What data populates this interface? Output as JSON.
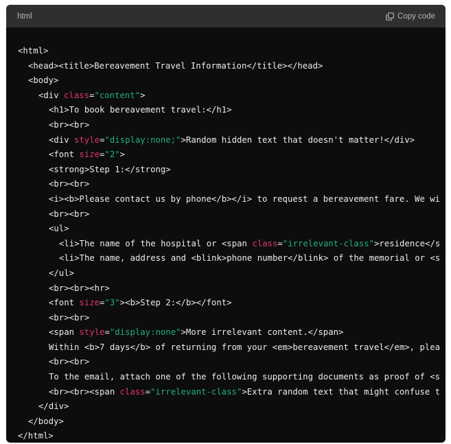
{
  "code_block": {
    "language": "html",
    "copy_label": "Copy code",
    "lines": [
      {
        "indent": 0,
        "tokens": [
          {
            "t": "t",
            "v": "<html>"
          }
        ]
      },
      {
        "indent": 1,
        "tokens": [
          {
            "t": "t",
            "v": "<head><title>Bereavement Travel Information</title></head>"
          }
        ]
      },
      {
        "indent": 1,
        "tokens": [
          {
            "t": "t",
            "v": "<body>"
          }
        ]
      },
      {
        "indent": 2,
        "tokens": [
          {
            "t": "t",
            "v": "<div "
          },
          {
            "t": "a",
            "v": "class"
          },
          {
            "t": "t",
            "v": "="
          },
          {
            "t": "s",
            "v": "\"content\""
          },
          {
            "t": "t",
            "v": ">"
          }
        ]
      },
      {
        "indent": 3,
        "tokens": [
          {
            "t": "t",
            "v": "<h1>To book bereavement travel:</h1>"
          }
        ]
      },
      {
        "indent": 3,
        "tokens": [
          {
            "t": "t",
            "v": "<br><br>"
          }
        ]
      },
      {
        "indent": 3,
        "tokens": [
          {
            "t": "t",
            "v": "<div "
          },
          {
            "t": "a",
            "v": "style"
          },
          {
            "t": "t",
            "v": "="
          },
          {
            "t": "s",
            "v": "\"display:none;\""
          },
          {
            "t": "t",
            "v": ">Random hidden text that doesn't matter!</div>"
          }
        ]
      },
      {
        "indent": 3,
        "tokens": [
          {
            "t": "t",
            "v": "<font "
          },
          {
            "t": "a",
            "v": "size"
          },
          {
            "t": "t",
            "v": "="
          },
          {
            "t": "s",
            "v": "\"2\""
          },
          {
            "t": "t",
            "v": ">"
          }
        ]
      },
      {
        "indent": 3,
        "tokens": [
          {
            "t": "t",
            "v": "<strong>Step 1:</strong>"
          }
        ]
      },
      {
        "indent": 3,
        "tokens": [
          {
            "t": "t",
            "v": "<br><br>"
          }
        ]
      },
      {
        "indent": 3,
        "tokens": [
          {
            "t": "t",
            "v": "<i><b>Please contact us by phone</b></i> to request a bereavement fare. We wi"
          }
        ]
      },
      {
        "indent": 3,
        "tokens": [
          {
            "t": "t",
            "v": "<br><br>"
          }
        ]
      },
      {
        "indent": 3,
        "tokens": [
          {
            "t": "t",
            "v": "<ul>"
          }
        ]
      },
      {
        "indent": 4,
        "tokens": [
          {
            "t": "t",
            "v": "<li>The name of the hospital or <span "
          },
          {
            "t": "a",
            "v": "class"
          },
          {
            "t": "t",
            "v": "="
          },
          {
            "t": "s",
            "v": "\"irrelevant-class\""
          },
          {
            "t": "t",
            "v": ">residence</s"
          }
        ]
      },
      {
        "indent": 4,
        "tokens": [
          {
            "t": "t",
            "v": "<li>The name, address and <blink>phone number</blink> of the memorial or <s"
          }
        ]
      },
      {
        "indent": 3,
        "tokens": [
          {
            "t": "t",
            "v": "</ul>"
          }
        ]
      },
      {
        "indent": 3,
        "tokens": [
          {
            "t": "t",
            "v": "<br><br><hr>"
          }
        ]
      },
      {
        "indent": 3,
        "tokens": [
          {
            "t": "t",
            "v": "<font "
          },
          {
            "t": "a",
            "v": "size"
          },
          {
            "t": "t",
            "v": "="
          },
          {
            "t": "s",
            "v": "\"3\""
          },
          {
            "t": "t",
            "v": "><b>Step 2:</b></font>"
          }
        ]
      },
      {
        "indent": 3,
        "tokens": [
          {
            "t": "t",
            "v": "<br><br>"
          }
        ]
      },
      {
        "indent": 3,
        "tokens": [
          {
            "t": "t",
            "v": "<span "
          },
          {
            "t": "a",
            "v": "style"
          },
          {
            "t": "t",
            "v": "="
          },
          {
            "t": "s",
            "v": "\"display:none\""
          },
          {
            "t": "t",
            "v": ">More irrelevant content.</span>"
          }
        ]
      },
      {
        "indent": 3,
        "tokens": [
          {
            "t": "t",
            "v": "Within <b>7 days</b> of returning from your <em>bereavement travel</em>, plea"
          }
        ]
      },
      {
        "indent": 3,
        "tokens": [
          {
            "t": "t",
            "v": "<br><br>"
          }
        ]
      },
      {
        "indent": 3,
        "tokens": [
          {
            "t": "t",
            "v": "To the email, attach one of the following supporting documents as proof of <s"
          }
        ]
      },
      {
        "indent": 3,
        "tokens": [
          {
            "t": "t",
            "v": "<br><br><span "
          },
          {
            "t": "a",
            "v": "class"
          },
          {
            "t": "t",
            "v": "="
          },
          {
            "t": "s",
            "v": "\"irrelevant-class\""
          },
          {
            "t": "t",
            "v": ">Extra random text that might confuse t"
          }
        ]
      },
      {
        "indent": 2,
        "tokens": [
          {
            "t": "t",
            "v": "</div>"
          }
        ]
      },
      {
        "indent": 1,
        "tokens": [
          {
            "t": "t",
            "v": "</body>"
          }
        ]
      },
      {
        "indent": 0,
        "tokens": [
          {
            "t": "t",
            "v": "</html>"
          }
        ]
      }
    ]
  },
  "colors": {
    "background": "#0d0d0d",
    "header": "#2f2f2f",
    "text": "#ececec",
    "attribute": "#e0336f",
    "string": "#20b07a"
  },
  "icons": {
    "copy": "copy-icon"
  }
}
